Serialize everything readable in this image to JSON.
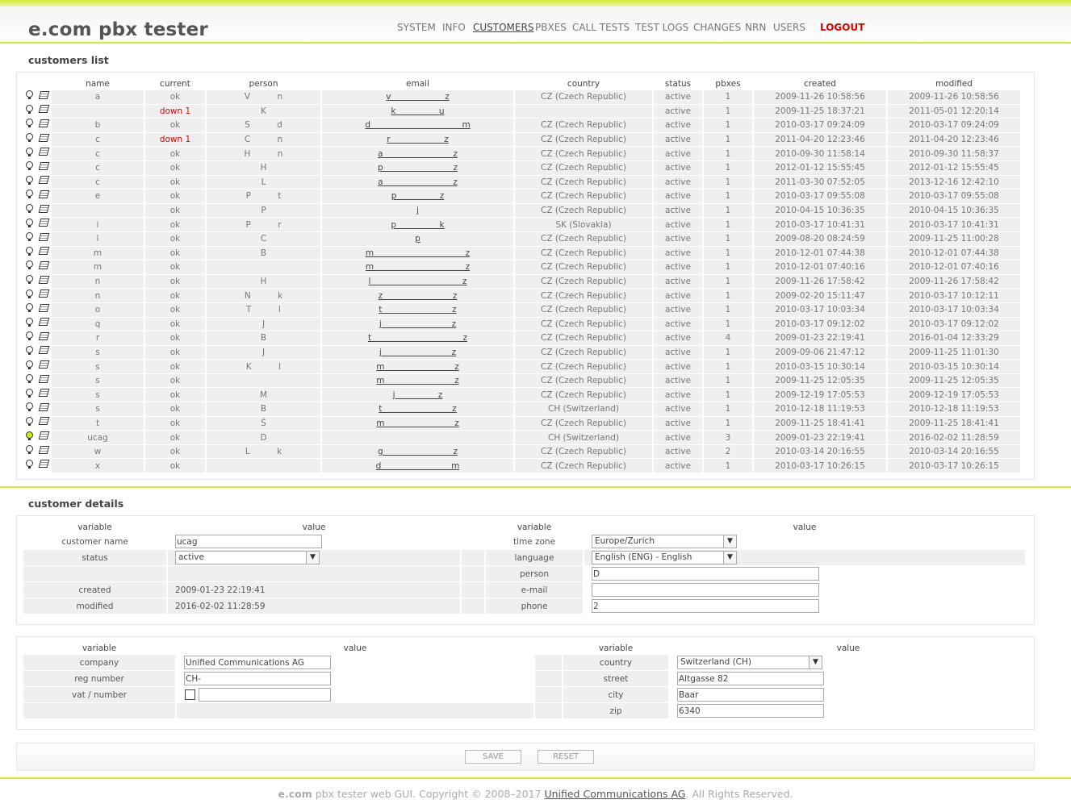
{
  "app": {
    "brand": "e.com pbx tester"
  },
  "nav": {
    "items": [
      "SYSTEM",
      "INFO",
      "CUSTOMERS",
      "PBXES",
      "CALL TESTS",
      "TEST LOGS",
      "CHANGES",
      "NRN",
      "USERS"
    ],
    "active": "CUSTOMERS",
    "logout": "LOGOUT"
  },
  "customers_list": {
    "title": "customers list",
    "columns": [
      "name",
      "current",
      "person",
      "email",
      "country",
      "status",
      "pbxes",
      "created",
      "modified"
    ],
    "rows": [
      {
        "name": "a",
        "current": "ok",
        "person": "V          n",
        "email": "v                    z",
        "country": "CZ (Czech Republic)",
        "status": "active",
        "pbxes": "1",
        "created": "2009-11-26 10:58:56",
        "modified": "2009-11-26 10:58:56"
      },
      {
        "name": "",
        "current": "down 1",
        "person": "K",
        "email": "k                u",
        "country": "",
        "status": "active",
        "pbxes": "1",
        "created": "2009-11-25 18:37:21",
        "modified": "2011-05-01 12:20:14"
      },
      {
        "name": "b",
        "current": "ok",
        "person": "S          d",
        "email": "d                                  m",
        "country": "CZ (Czech Republic)",
        "status": "active",
        "pbxes": "1",
        "created": "2010-03-17 09:24:09",
        "modified": "2010-03-17 09:24:09"
      },
      {
        "name": "c",
        "current": "down 1",
        "person": "C          n",
        "email": "r                    z",
        "country": "CZ (Czech Republic)",
        "status": "active",
        "pbxes": "1",
        "created": "2011-04-20 12:23:46",
        "modified": "2011-04-20 12:23:46"
      },
      {
        "name": "c",
        "current": "ok",
        "person": "H          n",
        "email": "a                          z",
        "country": "CZ (Czech Republic)",
        "status": "active",
        "pbxes": "1",
        "created": "2010-09-30 11:58:14",
        "modified": "2010-09-30 11:58:37"
      },
      {
        "name": "c",
        "current": "ok",
        "person": "H",
        "email": "p                          z",
        "country": "CZ (Czech Republic)",
        "status": "active",
        "pbxes": "1",
        "created": "2012-01-12 15:55:45",
        "modified": "2012-01-12 15:55:45"
      },
      {
        "name": "c",
        "current": "ok",
        "person": "L",
        "email": "a                          z",
        "country": "CZ (Czech Republic)",
        "status": "active",
        "pbxes": "1",
        "created": "2011-03-30 07:52:05",
        "modified": "2013-12-16 12:42:10"
      },
      {
        "name": "e",
        "current": "ok",
        "person": "P          t",
        "email": "p                z",
        "country": "CZ (Czech Republic)",
        "status": "active",
        "pbxes": "1",
        "created": "2010-03-17 09:55:08",
        "modified": "2010-03-17 09:55:08"
      },
      {
        "name": "",
        "current": "ok",
        "person": "P",
        "email": "j",
        "country": "CZ (Czech Republic)",
        "status": "active",
        "pbxes": "1",
        "created": "2010-04-15 10:36:35",
        "modified": "2010-04-15 10:36:35"
      },
      {
        "name": "i",
        "current": "ok",
        "person": "P          r",
        "email": "p                k",
        "country": "SK (Slovakia)",
        "status": "active",
        "pbxes": "1",
        "created": "2010-03-17 10:41:31",
        "modified": "2010-03-17 10:41:31"
      },
      {
        "name": "l",
        "current": "ok",
        "person": "C",
        "email": "p",
        "country": "CZ (Czech Republic)",
        "status": "active",
        "pbxes": "1",
        "created": "2009-08-20 08:24:59",
        "modified": "2009-11-25 11:00:28"
      },
      {
        "name": "m",
        "current": "ok",
        "person": "B",
        "email": "m                                  z",
        "country": "CZ (Czech Republic)",
        "status": "active",
        "pbxes": "1",
        "created": "2010-12-01 07:44:38",
        "modified": "2010-12-01 07:44:38"
      },
      {
        "name": "m",
        "current": "ok",
        "person": "",
        "email": "m                                  z",
        "country": "CZ (Czech Republic)",
        "status": "active",
        "pbxes": "1",
        "created": "2010-12-01 07:40:16",
        "modified": "2010-12-01 07:40:16"
      },
      {
        "name": "n",
        "current": "ok",
        "person": "H",
        "email": "l                                  z",
        "country": "CZ (Czech Republic)",
        "status": "active",
        "pbxes": "1",
        "created": "2009-11-26 17:58:42",
        "modified": "2009-11-26 17:58:42"
      },
      {
        "name": "n",
        "current": "ok",
        "person": "N          k",
        "email": "z                          z",
        "country": "CZ (Czech Republic)",
        "status": "active",
        "pbxes": "1",
        "created": "2009-02-20 15:11:47",
        "modified": "2010-03-17 10:12:11"
      },
      {
        "name": "o",
        "current": "ok",
        "person": "T          l",
        "email": "t                          z",
        "country": "CZ (Czech Republic)",
        "status": "active",
        "pbxes": "1",
        "created": "2010-03-17 10:03:34",
        "modified": "2010-03-17 10:03:34"
      },
      {
        "name": "q",
        "current": "ok",
        "person": "J",
        "email": "j                          z",
        "country": "CZ (Czech Republic)",
        "status": "active",
        "pbxes": "1",
        "created": "2010-03-17 09:12:02",
        "modified": "2010-03-17 09:12:02"
      },
      {
        "name": "r",
        "current": "ok",
        "person": "B",
        "email": "t                                  z",
        "country": "CZ (Czech Republic)",
        "status": "active",
        "pbxes": "4",
        "created": "2009-01-23 22:19:41",
        "modified": "2016-01-04 12:33:29"
      },
      {
        "name": "s",
        "current": "ok",
        "person": "J",
        "email": "j                          z",
        "country": "CZ (Czech Republic)",
        "status": "active",
        "pbxes": "1",
        "created": "2009-09-06 21:47:12",
        "modified": "2009-11-25 11:01:30"
      },
      {
        "name": "s",
        "current": "ok",
        "person": "K          l",
        "email": "m                          z",
        "country": "CZ (Czech Republic)",
        "status": "active",
        "pbxes": "1",
        "created": "2010-03-15 10:30:14",
        "modified": "2010-03-15 10:30:14"
      },
      {
        "name": "s",
        "current": "ok",
        "person": "",
        "email": "m                          z",
        "country": "CZ (Czech Republic)",
        "status": "active",
        "pbxes": "1",
        "created": "2009-11-25 12:05:35",
        "modified": "2009-11-25 12:05:35"
      },
      {
        "name": "s",
        "current": "ok",
        "person": "M",
        "email": "j                z",
        "country": "CZ (Czech Republic)",
        "status": "active",
        "pbxes": "1",
        "created": "2009-12-19 17:05:53",
        "modified": "2009-12-19 17:05:53"
      },
      {
        "name": "s",
        "current": "ok",
        "person": "B",
        "email": "t                          z",
        "country": "CH (Switzerland)",
        "status": "active",
        "pbxes": "1",
        "created": "2010-12-18 11:19:53",
        "modified": "2010-12-18 11:19:53"
      },
      {
        "name": "t",
        "current": "ok",
        "person": "Š",
        "email": "m                          z",
        "country": "CZ (Czech Republic)",
        "status": "active",
        "pbxes": "1",
        "created": "2009-11-25 18:41:41",
        "modified": "2009-11-25 18:41:41"
      },
      {
        "name": "ucag",
        "current": "ok",
        "person": "D",
        "email": "",
        "country": "CH (Switzerland)",
        "status": "active",
        "pbxes": "3",
        "created": "2009-01-23 22:19:41",
        "modified": "2016-02-02 11:28:59",
        "selected": true
      },
      {
        "name": "w",
        "current": "ok",
        "person": "L          k",
        "email": "g                          z",
        "country": "CZ (Czech Republic)",
        "status": "active",
        "pbxes": "2",
        "created": "2010-03-14 20:16:55",
        "modified": "2010-03-14 20:16:55"
      },
      {
        "name": "x",
        "current": "ok",
        "person": "",
        "email": "d                          m",
        "country": "CZ (Czech Republic)",
        "status": "active",
        "pbxes": "1",
        "created": "2010-03-17 10:26:15",
        "modified": "2010-03-17 10:26:15"
      }
    ]
  },
  "customer_details": {
    "title": "customer details",
    "header": {
      "variable": "variable",
      "value": "value"
    },
    "left": {
      "customer_name_label": "customer name",
      "customer_name_value": "ucag",
      "status_label": "status",
      "status_value": "active",
      "created_label": "created",
      "created_value": "2009-01-23  22:19:41",
      "modified_label": "modified",
      "modified_value": "2016-02-02  11:28:59"
    },
    "right": {
      "timezone_label": "time zone",
      "timezone_value": "Europe/Zurich",
      "language_label": "language",
      "language_value": "English (ENG) - English",
      "person_label": "person",
      "person_value": "D",
      "email_label": "e-mail",
      "email_value": "",
      "phone_label": "phone",
      "phone_value": "2"
    }
  },
  "company_details": {
    "left": {
      "company_label": "company",
      "company_value": "Unified Communications AG",
      "reg_label": "reg number",
      "reg_value": "CH-",
      "vat_label": "vat / number",
      "vat_value": ""
    },
    "right": {
      "country_label": "country",
      "country_value": "Switzerland (CH)",
      "street_label": "street",
      "street_value": "Altgasse 82",
      "city_label": "city",
      "city_value": "Baar",
      "zip_label": "zip",
      "zip_value": "6340"
    }
  },
  "buttons": {
    "save": "SAVE",
    "reset": "RESET"
  },
  "footer": {
    "brand": "e.com",
    "text": " pbx tester web GUI. Copyright © 2008–2017 ",
    "link": "Unified Communications AG",
    "tail": ". All Rights Reserved."
  },
  "colors": {
    "accent": "#d4ea2e",
    "alert": "#e00000",
    "selected_bulb": "#c7f000"
  }
}
